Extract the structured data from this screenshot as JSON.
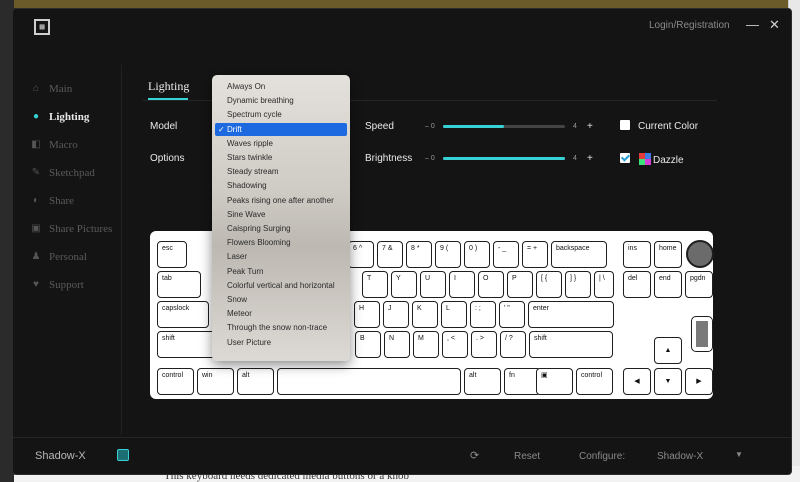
{
  "background": {
    "bottom_text": "This keyboard needs dedicated media buttons or a knob"
  },
  "window": {
    "login_label": "Login/Registration",
    "logo_icon": "logo-icon",
    "minimize_icon": "minimize-icon",
    "close_icon": "close-icon",
    "accent_color": "#36d2d6"
  },
  "sidebar": {
    "items": [
      {
        "label": "Main",
        "icon": "home-icon"
      },
      {
        "label": "Lighting",
        "icon": "bulb-icon",
        "active": true
      },
      {
        "label": "Macro",
        "icon": "macro-icon"
      },
      {
        "label": "Sketchpad",
        "icon": "sketchpad-icon"
      },
      {
        "label": "Share",
        "icon": "share-icon"
      },
      {
        "label": "Share Pictures",
        "icon": "share-pictures-icon"
      },
      {
        "label": "Personal",
        "icon": "person-icon"
      },
      {
        "label": "Support",
        "icon": "heart-icon"
      }
    ]
  },
  "main": {
    "tab_label": "Lighting",
    "model_label": "Model",
    "options_label": "Options",
    "speed": {
      "label": "Speed",
      "min": "0",
      "max": "4",
      "plus": "+",
      "minus": "–",
      "value_fraction": 0.5
    },
    "brightness": {
      "label": "Brightness",
      "min": "0",
      "max": "4",
      "plus": "+",
      "minus": "–",
      "value_fraction": 1.0
    },
    "current_color": {
      "label": "Current Color",
      "checked": false
    },
    "dazzle": {
      "label": "Dazzle",
      "checked": true
    }
  },
  "dropdown": {
    "selected": "Drift",
    "options": [
      "Always On",
      "Dynamic breathing",
      "Spectrum cycle",
      "Drift",
      "Waves ripple",
      "Stars twinkle",
      "Steady stream",
      "Shadowing",
      "Peaks rising one after another",
      "Sine Wave",
      "Caispring Surging",
      "Flowers Blooming",
      "Laser",
      "Peak Turn",
      "Colorful vertical and horizontal",
      "Snow",
      "Meteor",
      "Through the snow non-trace",
      "User Picture"
    ]
  },
  "keyboard": {
    "keys": {
      "esc": "esc",
      "k6": "6 ^",
      "k7": "7 &",
      "k8": "8 *",
      "k9": "9 (",
      "k0": "0 )",
      "minus": "- _",
      "equal": "= +",
      "backspace": "backspace",
      "ins": "ins",
      "home": "home",
      "tab": "tab",
      "t": "T",
      "y": "Y",
      "u": "U",
      "i": "I",
      "o": "O",
      "p": "P",
      "lbr": "[ {",
      "rbr": "] }",
      "bslash": "| \\",
      "del": "del",
      "end": "end",
      "pgdn": "pgdn",
      "capslock": "capslock",
      "h": "H",
      "j": "J",
      "k": "K",
      "l": "L",
      "semi": ": ;",
      "quote": "' \"",
      "enter": "enter",
      "lshift": "shift",
      "b": "B",
      "n": "N",
      "m": "M",
      "comma": ", <",
      "period": ". >",
      "slash": "/ ?",
      "rshift": "shift",
      "up": "▲",
      "lctrl": "control",
      "win": "win",
      "lalt": "alt",
      "ralt": "alt",
      "fn": "fn",
      "menu": "▣",
      "rctrl": "control",
      "left": "◀",
      "down": "▼",
      "right": "▶"
    }
  },
  "bottombar": {
    "device": "Shadow-X",
    "reset_label": "Reset",
    "configure_label": "Configure:",
    "configure_value": "Shadow-X"
  }
}
